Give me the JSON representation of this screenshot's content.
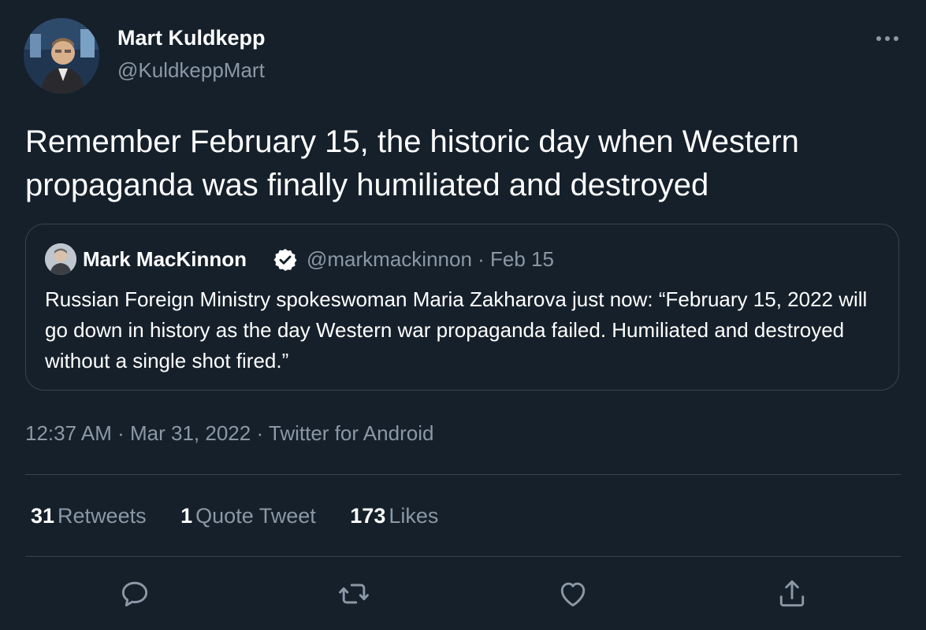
{
  "author": {
    "name": "Mart Kuldkepp",
    "handle": "@KuldkeppMart"
  },
  "tweet_text": "Remember February 15, the historic day when Western propaganda was finally humiliated and destroyed",
  "quoted_tweet": {
    "name": "Mark MacKinnon",
    "verified": true,
    "handle": "@markmackinnon",
    "separator": "·",
    "date": "Feb 15",
    "text": "Russian Foreign Ministry spokeswoman Maria Zakharova just now: “February 15, 2022 will go down in history as the day Western war propaganda failed. Humiliated and destroyed without a single shot fired.”"
  },
  "meta": {
    "time": "12:37 AM",
    "separator": "·",
    "date": "Mar 31, 2022",
    "source": "Twitter for Android"
  },
  "stats": {
    "retweets_count": "31",
    "retweets_label": "Retweets",
    "quotes_count": "1",
    "quotes_label": "Quote Tweet",
    "likes_count": "173",
    "likes_label": "Likes"
  },
  "icons": {
    "more": "more-dots-icon",
    "reply": "reply-icon",
    "retweet": "retweet-icon",
    "like": "heart-icon",
    "share": "share-icon",
    "verified": "verified-badge-icon"
  },
  "colors": {
    "background": "#15202b",
    "secondary_text": "#8b98a5",
    "border": "#38444d",
    "primary_text": "#ffffff"
  }
}
